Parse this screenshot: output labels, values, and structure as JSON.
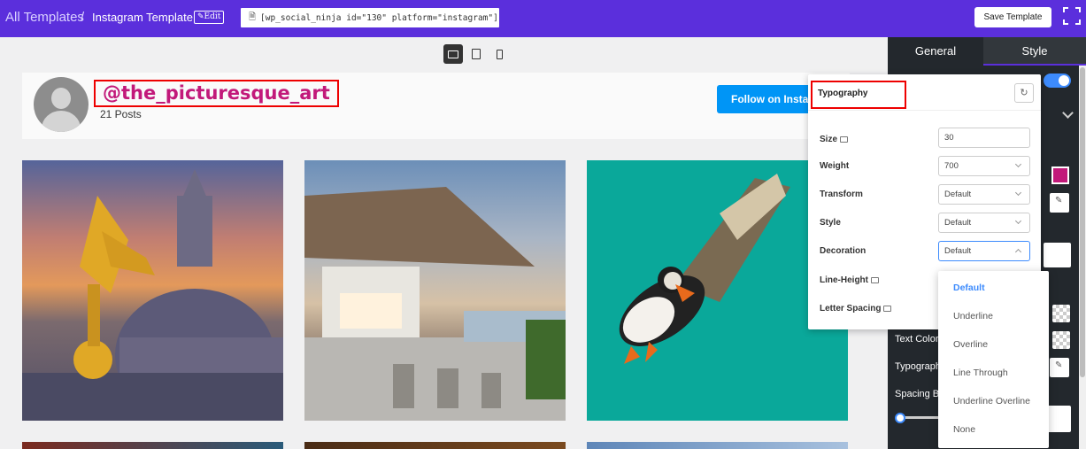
{
  "topbar": {
    "breadcrumb_root": "All Templates",
    "separator": "/",
    "current": "Instagram Template",
    "edit_label": "Edit",
    "shortcode": "[wp_social_ninja id=\"130\" platform=\"instagram\"]",
    "save_label": "Save Template",
    "accent_color": "#5b2fdc"
  },
  "devices": [
    "desktop-icon",
    "tablet-icon",
    "mobile-icon"
  ],
  "profile": {
    "username": "@the_picturesque_art",
    "posts": "21 Posts",
    "follow_label": "Follow on Instagram",
    "username_color": "#c2197a"
  },
  "panel": {
    "tabs": [
      "General",
      "Style"
    ],
    "labels": {
      "text_color": "Text Color",
      "typography": "Typography",
      "spacing": "Spacing B"
    }
  },
  "typography": {
    "title": "Typography",
    "rows": [
      {
        "label": "Size",
        "value": "30",
        "type": "input"
      },
      {
        "label": "Weight",
        "value": "700",
        "type": "select"
      },
      {
        "label": "Transform",
        "value": "Default",
        "type": "select"
      },
      {
        "label": "Style",
        "value": "Default",
        "type": "select"
      },
      {
        "label": "Decoration",
        "value": "Default",
        "type": "select"
      },
      {
        "label": "Line-Height",
        "value": "",
        "type": "input"
      },
      {
        "label": "Letter Spacing",
        "value": "",
        "type": "input"
      }
    ]
  },
  "decoration_options": [
    "Default",
    "Underline",
    "Overline",
    "Line Through",
    "Underline Overline",
    "None"
  ],
  "decoration_selected": "Default"
}
